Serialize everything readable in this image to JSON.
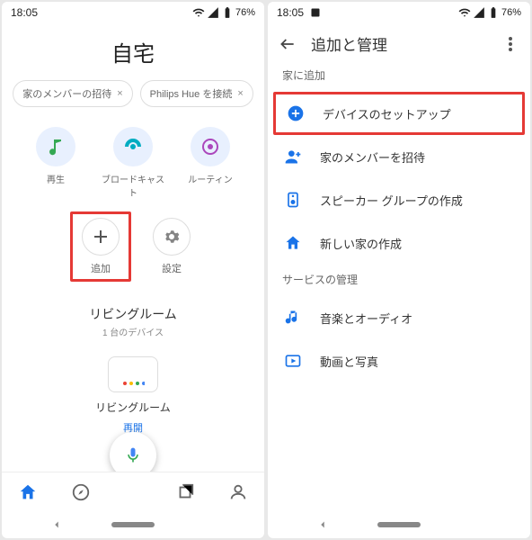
{
  "statusbar": {
    "time": "18:05",
    "battery": "76%"
  },
  "left": {
    "title": "自宅",
    "chips": [
      {
        "label": "家のメンバーの招待"
      },
      {
        "label": "Philips Hue を接続"
      }
    ],
    "topActions": [
      {
        "label": "再生"
      },
      {
        "label": "ブロードキャスト"
      },
      {
        "label": "ルーティン"
      }
    ],
    "mainActions": [
      {
        "label": "追加"
      },
      {
        "label": "設定"
      }
    ],
    "room": {
      "name": "リビングルーム",
      "sub": "1 台のデバイス",
      "device": {
        "name": "リビングルーム",
        "link": "再開"
      }
    }
  },
  "right": {
    "title": "追加と管理",
    "section1": "家に追加",
    "items1": [
      {
        "label": "デバイスのセットアップ"
      },
      {
        "label": "家のメンバーを招待"
      },
      {
        "label": "スピーカー グループの作成"
      },
      {
        "label": "新しい家の作成"
      }
    ],
    "section2": "サービスの管理",
    "items2": [
      {
        "label": "音楽とオーディオ"
      },
      {
        "label": "動画と写真"
      }
    ]
  }
}
